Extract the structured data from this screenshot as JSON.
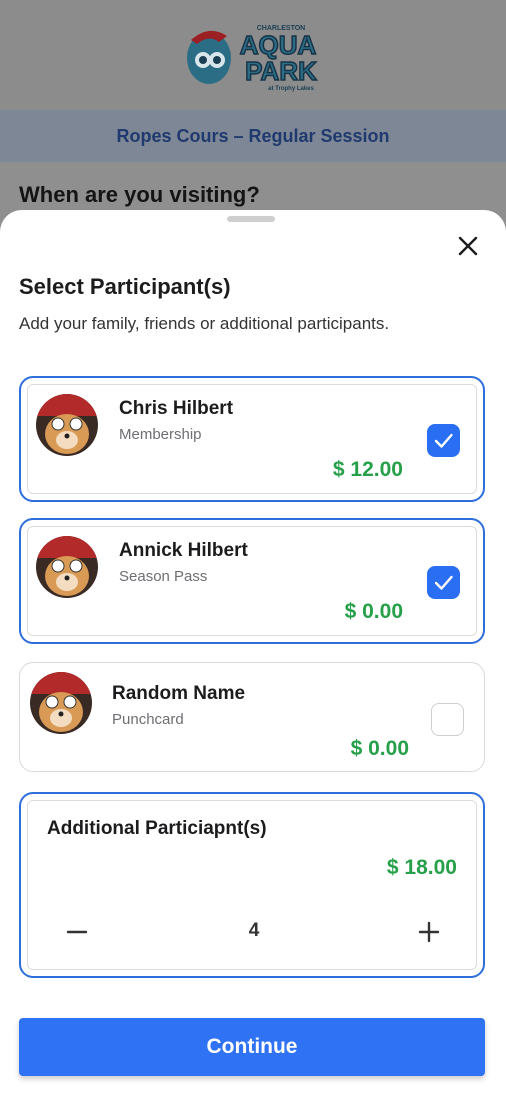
{
  "header": {
    "logo_top": "CHARLESTON",
    "logo_main_1": "AQUA",
    "logo_main_2": "PARK",
    "logo_bottom": "at Trophy Lakes"
  },
  "session": {
    "title": "Ropes Cours – Regular Session"
  },
  "background": {
    "heading": "When are you visiting?"
  },
  "sheet": {
    "title": "Select Participant(s)",
    "subtitle": "Add your family, friends or additional participants.",
    "close_icon": "close-icon"
  },
  "participants": [
    {
      "name": "Chris Hilbert",
      "type": "Membership",
      "price": "$ 12.00",
      "checked": true
    },
    {
      "name": "Annick Hilbert",
      "type": "Season Pass",
      "price": "$ 0.00",
      "checked": true
    },
    {
      "name": "Random Name",
      "type": "Punchcard",
      "price": "$ 0.00",
      "checked": false
    }
  ],
  "additional": {
    "title": "Additional Particiapnt(s)",
    "price": "$ 18.00",
    "quantity": "4"
  },
  "continue": {
    "label": "Continue"
  },
  "colors": {
    "accent": "#2f73f4",
    "price": "#27a04a",
    "selected_border": "#2f6fdb"
  }
}
